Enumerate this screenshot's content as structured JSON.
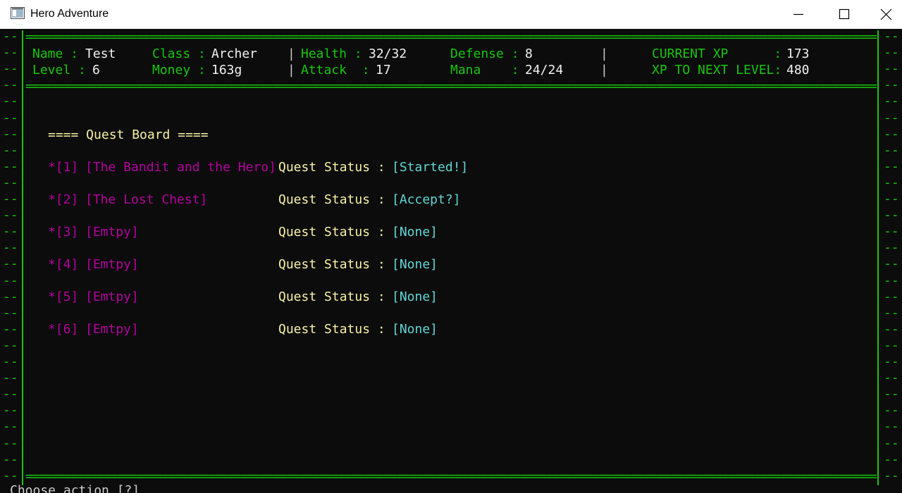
{
  "window": {
    "title": "Hero Adventure"
  },
  "colors": {
    "terminal_bg": "#0c0c0c",
    "frame": "#16c60c",
    "label": "#16c60c",
    "value": "#f2f2f2",
    "heading": "#f9f1a5",
    "quest_name": "#b4009e",
    "quest_status": "#61d6d6"
  },
  "icons": {
    "app": "console-app-icon",
    "minimize": "minimize-icon",
    "maximize": "maximize-icon",
    "close": "close-icon"
  },
  "frame": {
    "side_marker": "--",
    "rule": "===================================================================================================================================================="
  },
  "stats": {
    "name_label": "Name :",
    "name_value": "Test",
    "class_label": "Class :",
    "class_value": "Archer",
    "level_label": "Level :",
    "level_value": "6",
    "money_label": "Money :",
    "money_value": "163g",
    "health_label": "Health :",
    "health_value": "32/32",
    "attack_label": "Attack  :",
    "attack_value": "17",
    "defense_label": "Defense :",
    "defense_value": "8",
    "mana_label": "Mana    :",
    "mana_value": "24/24",
    "current_xp_label": "CURRENT XP      :",
    "current_xp_value": "173",
    "next_level_label": "XP TO NEXT LEVEL:",
    "next_level_value": "480"
  },
  "quest_board": {
    "heading": "==== Quest Board ====",
    "status_label": "Quest Status :",
    "quests": [
      {
        "index": "*[1]",
        "name": "[The Bandit and the Hero]",
        "status": "[Started!]"
      },
      {
        "index": "*[2]",
        "name": "[The Lost Chest]",
        "status": "[Accept?]"
      },
      {
        "index": "*[3]",
        "name": "[Emtpy]",
        "status": "[None]"
      },
      {
        "index": "*[4]",
        "name": "[Emtpy]",
        "status": "[None]"
      },
      {
        "index": "*[5]",
        "name": "[Emtpy]",
        "status": "[None]"
      },
      {
        "index": "*[6]",
        "name": "[Emtpy]",
        "status": "[None]"
      }
    ]
  },
  "prompt": {
    "text": "Choose action [?]"
  }
}
